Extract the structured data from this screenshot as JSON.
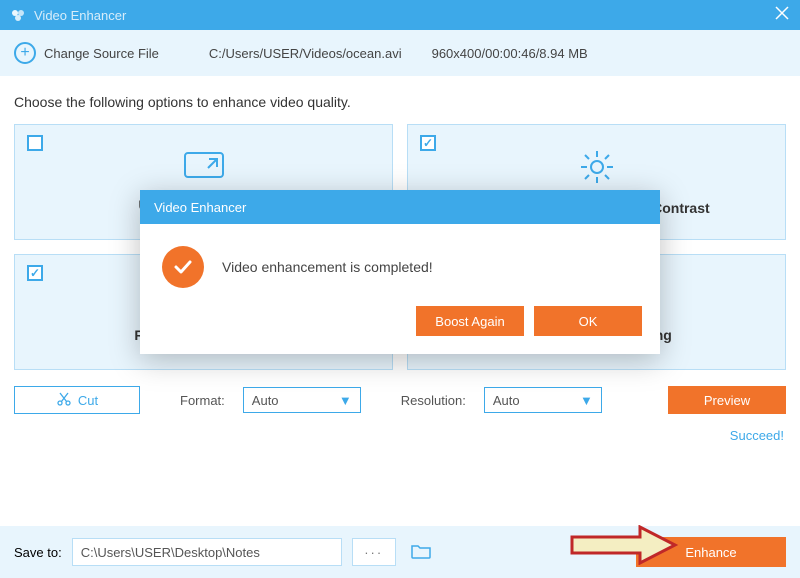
{
  "titlebar": {
    "title": "Video Enhancer"
  },
  "source": {
    "change_label": "Change Source File",
    "path": "C:/Users/USER/Videos/ocean.avi",
    "info": "960x400/00:00:46/8.94 MB"
  },
  "instruction": "Choose the following options to enhance video quality.",
  "options": {
    "upscale": {
      "label": "Upscale Resolution",
      "checked": false
    },
    "brightness": {
      "label": "Optimize Brightness and Contrast",
      "checked": true
    },
    "noise": {
      "label": "Remove Video Noise",
      "checked": true
    },
    "shaking": {
      "label": "Reduce Video Shaking",
      "checked": true
    }
  },
  "controls": {
    "cut_label": "Cut",
    "format_label": "Format:",
    "format_value": "Auto",
    "resolution_label": "Resolution:",
    "resolution_value": "Auto",
    "preview_label": "Preview",
    "succeed_label": "Succeed!"
  },
  "savebar": {
    "label": "Save to:",
    "path": "C:\\Users\\USER\\Desktop\\Notes",
    "more": "···",
    "enhance_label": "Enhance"
  },
  "modal": {
    "title": "Video Enhancer",
    "message": "Video enhancement is completed!",
    "boost_label": "Boost Again",
    "ok_label": "OK"
  }
}
